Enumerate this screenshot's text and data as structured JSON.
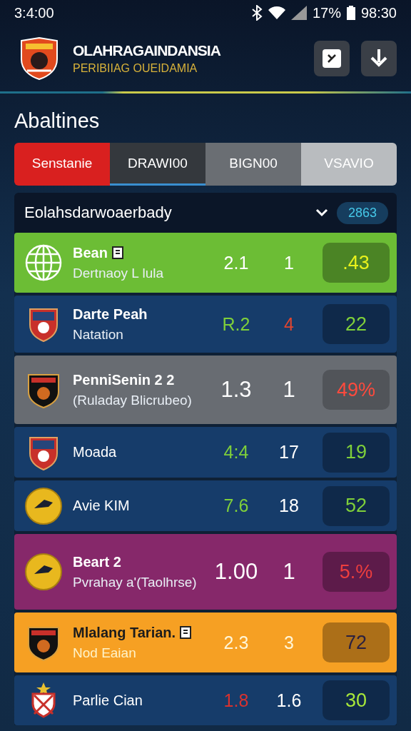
{
  "status_bar": {
    "time": "3:4:00",
    "battery": "17%",
    "clock": "98:30"
  },
  "header": {
    "title": "OLAHRAGAINDANSIA",
    "subtitle": "PERIBIIAG OUEIDAMIA"
  },
  "section_title": "Abaltines",
  "tabs": [
    {
      "label": "Senstanie",
      "selected": false,
      "color": "#d9201f"
    },
    {
      "label": "DRAWI00",
      "selected": true,
      "color": "#34383d"
    },
    {
      "label": "BIGN00",
      "selected": false,
      "color": "#6a6e73"
    },
    {
      "label": "VSAVIO",
      "selected": false,
      "color": "#b9bcbf"
    }
  ],
  "list_header": {
    "title": "Eolahsdarwoaerbady",
    "expanded": true,
    "count": "2863"
  },
  "rows": [
    {
      "kind": "globe",
      "color": "#6cbd35",
      "name": "Bean",
      "flagged": true,
      "subtitle": "Dertnaoy L lula",
      "stats": [
        {
          "text": "2.1",
          "color": "#ffffff"
        },
        {
          "text": "1",
          "color": "#ffffff"
        }
      ],
      "badge": {
        "text": ".43",
        "color": "#e9f21c"
      }
    },
    {
      "kind": "shield",
      "color": "#163c6a",
      "name": "Darte Peah",
      "flagged": false,
      "subtitle": "Natation",
      "stats": [
        {
          "text": "R.2",
          "color": "#7fd03a"
        },
        {
          "text": "4",
          "color": "#e0452f"
        }
      ],
      "badge": {
        "text": "22",
        "color": "#7fd03a"
      }
    },
    {
      "kind": "crest",
      "color": "#686c72",
      "name": "PenniSenin 2 2",
      "flagged": false,
      "subtitle": "(Ruladay Blicrubeo)",
      "stats": [
        {
          "text": "1.3",
          "color": "#ffffff"
        },
        {
          "text": "1",
          "color": "#ffffff"
        }
      ],
      "badge": {
        "text": "49%",
        "color": "#ff4a3d"
      }
    },
    {
      "kind": "shield",
      "color": "#163c6a",
      "name": "Moada",
      "flagged": false,
      "stats": [
        {
          "text": "4:4",
          "color": "#7fd03a"
        },
        {
          "text": "17",
          "color": "#ffffff"
        }
      ],
      "badge": {
        "text": "19",
        "color": "#7fd03a"
      }
    },
    {
      "kind": "round",
      "color": "#163c6a",
      "name": "Avie KIM",
      "flagged": false,
      "stats": [
        {
          "text": "7.6",
          "color": "#7fd03a"
        },
        {
          "text": "18",
          "color": "#ffffff"
        }
      ],
      "badge": {
        "text": "52",
        "color": "#7fd03a"
      }
    },
    {
      "kind": "round",
      "color": "#86286a",
      "name": "Beart 2",
      "flagged": false,
      "subtitle": "Pvrahay a'(Taolhrse)",
      "stats": [
        {
          "text": "1.00",
          "color": "#ffffff"
        },
        {
          "text": "1",
          "color": "#ffffff"
        }
      ],
      "badge": {
        "text": "5.%",
        "color": "#ee3e3e"
      }
    },
    {
      "kind": "crest",
      "color": "#f6a023",
      "name": "Mlalang Tarian.",
      "flagged": true,
      "subtitle": "Nod Eaian",
      "stats": [
        {
          "text": "2.3",
          "color": "#fff6d8"
        },
        {
          "text": "3",
          "color": "#fff6d8"
        }
      ],
      "badge": {
        "text": "72",
        "color": "#2a2040"
      }
    },
    {
      "kind": "star",
      "color": "#163c6a",
      "name": "Parlie Cian",
      "flagged": false,
      "stats": [
        {
          "text": "1.8",
          "color": "#d8322f"
        },
        {
          "text": "1.6",
          "color": "#ffffff"
        }
      ],
      "badge": {
        "text": "30",
        "color": "#a8e83a"
      }
    }
  ]
}
